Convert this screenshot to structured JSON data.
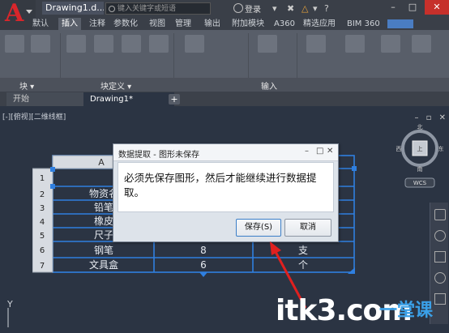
{
  "titlebar": {
    "document_title": "Drawing1.d...",
    "search_placeholder": "键入关键字或短语",
    "login_label": "登录",
    "win_min": "–",
    "win_max": "□",
    "win_close": "✕"
  },
  "ribbon_tabs": [
    "默认",
    "插入",
    "注释",
    "参数化",
    "视图",
    "管理",
    "输出",
    "附加模块",
    "A360",
    "精选应用",
    "BIM 360"
  ],
  "active_tab": "插入",
  "panels": [
    "块 ▾",
    "块定义 ▾",
    "输入"
  ],
  "file_tabs": {
    "start": "开始",
    "drawing": "Drawing1*",
    "add": "+"
  },
  "viewport_label": "[-][俯视][二维线框]",
  "viewcube": {
    "north": "北",
    "south": "南",
    "west": "西",
    "east": "东",
    "top_face": "上",
    "wcs": "WCS"
  },
  "table": {
    "header": "A",
    "row_numbers": [
      "1",
      "2",
      "3",
      "4",
      "5",
      "6",
      "7"
    ],
    "col_b_visible": [
      "",
      "物资名",
      "铅笔",
      "橡皮",
      "尺子",
      "钢笔",
      "文具盒"
    ],
    "col_c_visible": [
      "",
      "",
      "",
      "",
      "",
      "8",
      "6"
    ],
    "col_d_visible": [
      "",
      "",
      "",
      "",
      "",
      "支",
      "个"
    ]
  },
  "dialog": {
    "title": "数据提取 - 图形未保存",
    "message": "必须先保存图形，然后才能继续进行数据提取。",
    "save_button": "保存(S)",
    "cancel_button": "取消",
    "min": "–",
    "restore": "□",
    "close": "✕"
  },
  "watermark": {
    "text": "itk3.com",
    "sub": "一堂课"
  },
  "ucs_label": "Y",
  "colors": {
    "accent_red": "#d9262b",
    "table_blue": "#2f7fe0",
    "drawing_bg": "#2b3443"
  }
}
